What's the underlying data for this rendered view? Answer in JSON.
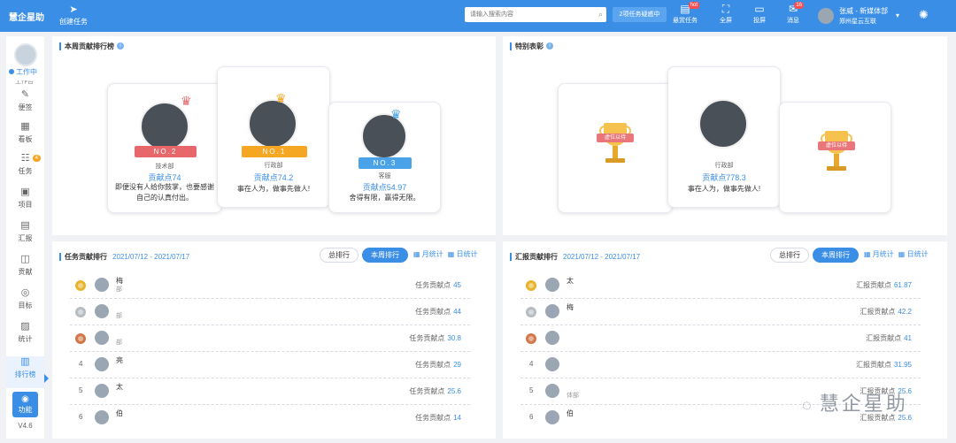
{
  "topbar": {
    "brand": "慧企星助",
    "create_task": "创建任务",
    "search_placeholder": "请输入搜索内容",
    "pending": "2项任务疑惑中",
    "items": [
      {
        "label": "悬赏任务",
        "icon": "bounty-icon",
        "glyph": "▤",
        "badge": "hot"
      },
      {
        "label": "全屏",
        "icon": "fullscreen-icon",
        "glyph": "⛶",
        "badge": ""
      },
      {
        "label": "投屏",
        "icon": "screen-cast-icon",
        "glyph": "▭",
        "badge": ""
      },
      {
        "label": "消息",
        "icon": "message-icon",
        "glyph": "✉",
        "badge": "16"
      }
    ],
    "user": {
      "name": "张威 - 新媒体部",
      "company": "郑州星云互联"
    },
    "bulb_glyph": "✺"
  },
  "sidebar": {
    "status": "工作中",
    "cut_text": "工作台",
    "items": [
      {
        "label": "便签",
        "icon": "note-icon",
        "glyph": "✎",
        "badge": ""
      },
      {
        "label": "看板",
        "icon": "board-icon",
        "glyph": "▦",
        "badge": ""
      },
      {
        "label": "任务",
        "icon": "task-icon",
        "glyph": "☷",
        "badge": "4"
      },
      {
        "label": "项目",
        "icon": "project-icon",
        "glyph": "▣",
        "badge": ""
      },
      {
        "label": "汇报",
        "icon": "report-icon",
        "glyph": "▤",
        "badge": ""
      },
      {
        "label": "贡献",
        "icon": "contribution-icon",
        "glyph": "◫",
        "badge": ""
      },
      {
        "label": "目标",
        "icon": "target-icon",
        "glyph": "◎",
        "badge": ""
      },
      {
        "label": "统计",
        "icon": "stats-icon",
        "glyph": "▨",
        "badge": ""
      },
      {
        "label": "排行榜",
        "icon": "leaderboard-icon",
        "glyph": "▥",
        "badge": ""
      }
    ],
    "function_label": "功能",
    "version": "V4.6"
  },
  "weekly_top": {
    "title": "本周贡献排行榜",
    "cards": [
      {
        "rank_label": "NO.2",
        "dept": "技术部",
        "score": "贡献点74",
        "motto": "即便没有人给你鼓掌，也要感谢自己的认真付出。",
        "ribbon_color": "#e8676b"
      },
      {
        "rank_label": "NO.1",
        "dept": "行政部",
        "score": "贡献点74.2",
        "motto": "事在人为，做事先做人!",
        "ribbon_color": "#f5a623"
      },
      {
        "rank_label": "NO.3",
        "dept": "客服",
        "score": "贡献点54.97",
        "motto": "舍得有限，赢得无限。",
        "ribbon_color": "#4aa3e8"
      }
    ]
  },
  "special": {
    "title": "特别表彰",
    "trophy_text": "虚位以待",
    "card": {
      "dept": "行政部",
      "score": "贡献点778.3",
      "motto": "事在人为，做事先做人!"
    }
  },
  "task_rank": {
    "title": "任务贡献排行",
    "dates": "2021/07/12 - 2021/07/17",
    "tabs": [
      "总排行",
      "本周排行",
      "月统计",
      "日统计"
    ],
    "value_label": "任务贡献点",
    "rows": [
      {
        "rank": "1",
        "name": "梅",
        "dept": "部",
        "value": "45"
      },
      {
        "rank": "2",
        "name": "",
        "dept": "部",
        "value": "44"
      },
      {
        "rank": "3",
        "name": "",
        "dept": "部",
        "value": "30.8"
      },
      {
        "rank": "4",
        "name": "亮",
        "dept": "",
        "value": "29"
      },
      {
        "rank": "5",
        "name": "太",
        "dept": "",
        "value": "25.6"
      },
      {
        "rank": "6",
        "name": "伯",
        "dept": "",
        "value": "14"
      }
    ]
  },
  "report_rank": {
    "title": "汇报贡献排行",
    "dates": "2021/07/12 - 2021/07/17",
    "tabs": [
      "总排行",
      "本周排行",
      "月统计",
      "日统计"
    ],
    "value_label": "汇报贡献点",
    "rows": [
      {
        "rank": "1",
        "name": "太",
        "dept": "",
        "value": "61.87"
      },
      {
        "rank": "2",
        "name": "梅",
        "dept": "",
        "value": "42.2"
      },
      {
        "rank": "3",
        "name": "",
        "dept": "",
        "value": "41"
      },
      {
        "rank": "4",
        "name": "",
        "dept": "",
        "value": "31.95"
      },
      {
        "rank": "5",
        "name": "",
        "dept": "体部",
        "value": "25.6"
      },
      {
        "rank": "6",
        "name": "伯",
        "dept": "",
        "value": "25.6"
      }
    ]
  },
  "watermark": "慧企星助"
}
